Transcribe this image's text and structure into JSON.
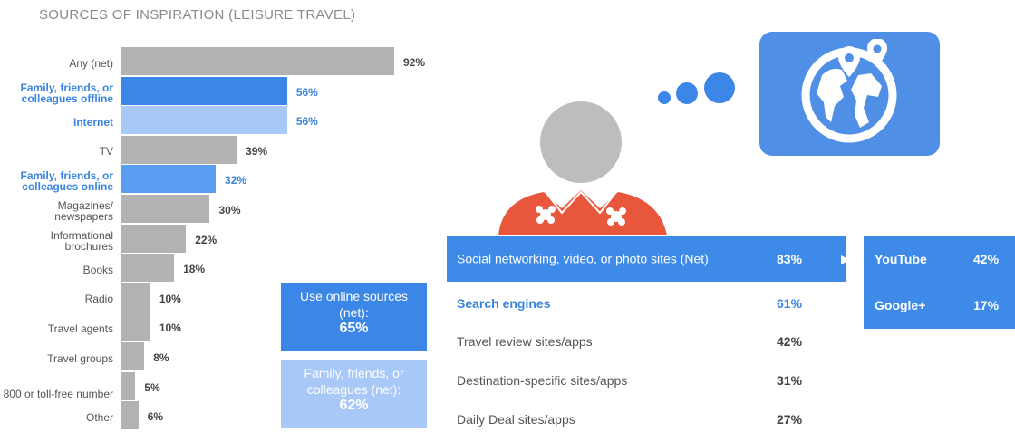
{
  "title": "SOURCES OF INSPIRATION (LEISURE TRAVEL)",
  "chart_data": {
    "type": "bar",
    "orientation": "horizontal",
    "categories": [
      "Any (net)",
      "Family, friends, or colleagues offline",
      "Internet",
      "TV",
      "Family, friends, or colleagues online",
      "Magazines/ newspapers",
      "Informational brochures",
      "Books",
      "Radio",
      "Travel agents",
      "Travel groups",
      "800 or toll-free number",
      "Other"
    ],
    "values": [
      92,
      56,
      56,
      39,
      32,
      30,
      22,
      18,
      10,
      10,
      8,
      5,
      6
    ],
    "value_labels": [
      "92%",
      "56%",
      "56%",
      "39%",
      "32%",
      "30%",
      "22%",
      "18%",
      "10%",
      "10%",
      "8%",
      "5%",
      "6%"
    ],
    "highlight": [
      false,
      true,
      true,
      false,
      true,
      false,
      false,
      false,
      false,
      false,
      false,
      false,
      false
    ],
    "bar_colors": [
      "#b3b3b3",
      "#3b86e6",
      "#a8c8f8",
      "#b3b3b3",
      "#5b9df0",
      "#b3b3b3",
      "#b3b3b3",
      "#b3b3b3",
      "#b3b3b3",
      "#b3b3b3",
      "#b3b3b3",
      "#b3b3b3",
      "#b3b3b3"
    ],
    "xlim": [
      0,
      100
    ],
    "grid": false
  },
  "callouts": [
    {
      "label": "Use online sources (net):",
      "value": "65%",
      "color": "#3b86e6",
      "text_color": "#ffffff"
    },
    {
      "label": "Family, friends, or colleagues (net):",
      "value": "62%",
      "color": "#a8c8f8",
      "text_color": "#ffffff"
    }
  ],
  "online_sources": [
    {
      "label": "Social networking, video, or photo sites (Net)",
      "value": "83%"
    },
    {
      "label": "Search engines",
      "value": "61%"
    },
    {
      "label": "Travel review sites/apps",
      "value": "42%"
    },
    {
      "label": "Destination-specific sites/apps",
      "value": "31%"
    },
    {
      "label": "Daily Deal sites/apps",
      "value": "27%"
    }
  ],
  "social_breakdown": [
    {
      "label": "YouTube",
      "value": "42%"
    },
    {
      "label": "Google+",
      "value": "17%"
    }
  ],
  "colors": {
    "accent": "#3b86e6",
    "accent_light": "#a8c8f8",
    "neutral_bar": "#b3b3b3",
    "avatar_head": "#bdbdbd",
    "shirt": "#e8573c",
    "globe_tile": "#4f8fe6"
  },
  "icons": {
    "globe": "globe-with-map-pins-icon",
    "thought": "thought-bubble-icon",
    "person": "traveler-avatar",
    "arrow": "play-arrow-icon"
  }
}
